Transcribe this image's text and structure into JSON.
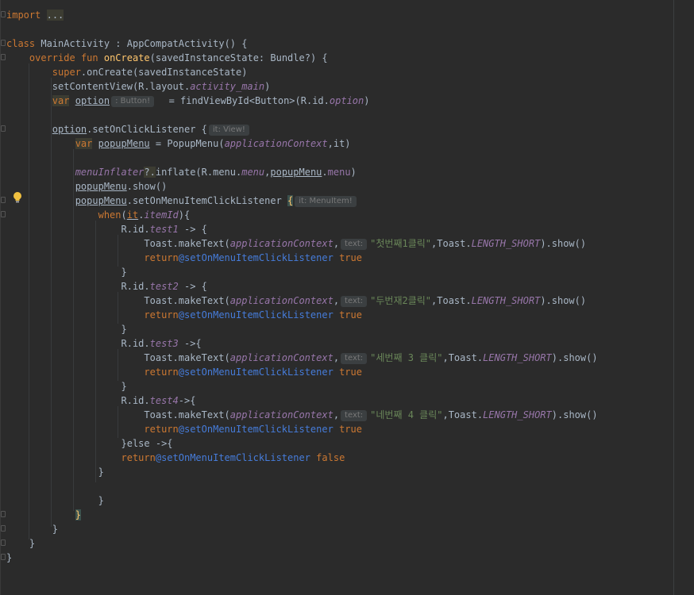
{
  "code": {
    "import_kw": "import",
    "import_fold": "...",
    "class_kw": "class",
    "class_name": "MainActivity",
    "colon": " : ",
    "superclass": "AppCompatActivity()",
    "open_brace": " {",
    "override_kw": "override",
    "fun_kw": "fun",
    "fun_name": "onCreate",
    "oncreate_params": "(savedInstanceState: Bundle?) {",
    "super_kw": "super",
    "super_call": ".onCreate(savedInstanceState)",
    "setcontent_a": "setContentView(R.layout.",
    "activity_main": "activity_main",
    "close_paren": ")",
    "var_kw": "var",
    "option_name": "option",
    "hint_button": ": Button!",
    "findview_a": "  = findViewById<Button>(R.id.",
    "option_id": "option",
    "listener_call": ".setOnClickListener ",
    "brace": "{",
    "hint_view": "it: View!",
    "popup_name": "popupMenu",
    "popup_ctor_a": " = PopupMenu(",
    "app_ctx": "applicationContext",
    "it_close": ",it)",
    "menu_inflater": "menuInflater",
    "safe_call": "?.",
    "inflate_a": "inflate(R.menu.",
    "menu_word": "menu",
    "comma": ",",
    "dot": ".",
    "show_call": ".show()",
    "item_listener_call": ".setOnMenuItemClickListener ",
    "hint_menuitem": "it: MenuItem!",
    "when_kw": "when",
    "when_open": "(",
    "it_kw": "it",
    "item_id": "itemId",
    "when_close": "){",
    "rid": "R.id.",
    "test1": "test1",
    "test2": "test2",
    "test3": "test3",
    "test4": "test4",
    "arrow_sp": " -> {",
    "arrow_tight_sp": " ->{",
    "arrow_tight": "->{",
    "toast_call": "Toast.makeText(",
    "hint_text": "text:",
    "msg1": "\"첫번째1클릭\"",
    "msg2": "\"두번재2클릭\"",
    "msg3": "\"세번째 3 클릭\"",
    "msg4": "\"네번째 4 클릭\"",
    "toast_mid": ",Toast.",
    "length_short": "LENGTH_SHORT",
    "toast_end": ").show()",
    "return_kw": "return",
    "return_label": "@setOnMenuItemClickListener",
    "true_kw": "true",
    "false_kw": "false",
    "close_brace": "}",
    "else_a": "}else ->{"
  }
}
